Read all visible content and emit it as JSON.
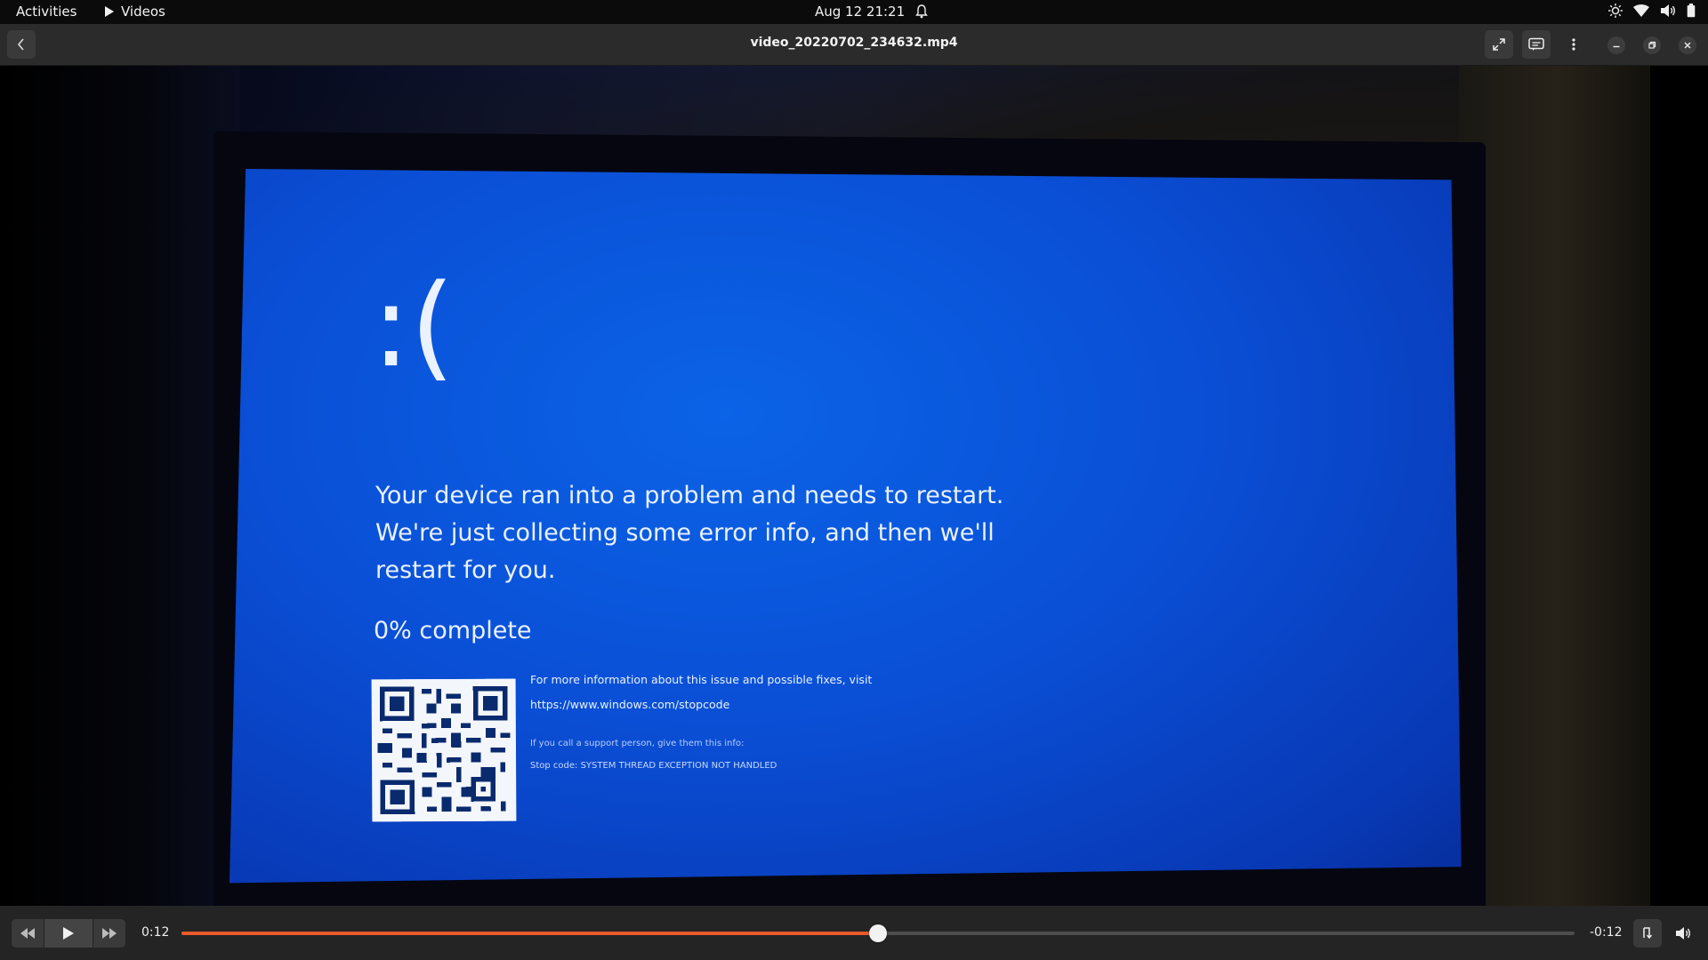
{
  "topbar": {
    "activities_label": "Activities",
    "app_name": "Videos",
    "clock": "Aug 12  21:21",
    "tray_icons": [
      "brightness-icon",
      "wifi-icon",
      "volume-icon",
      "battery-icon"
    ]
  },
  "header": {
    "title": "video_20220702_234632.mp4",
    "buttons": [
      "back",
      "fullscreen",
      "subtitles",
      "menu",
      "minimize",
      "restore",
      "close"
    ]
  },
  "video": {
    "sad_face": ":(",
    "message": "Your device ran into a problem and needs to restart. We're just collecting some error info, and then we'll restart for you.",
    "progress": "0% complete",
    "more_info": "For more information about this issue and possible fixes, visit",
    "url": "https://www.windows.com/stopcode",
    "support": "If you call a support person, give them this info:",
    "stop_code": "Stop code: SYSTEM THREAD EXCEPTION NOT HANDLED"
  },
  "player": {
    "elapsed": "0:12",
    "remaining": "-0:12",
    "progress_fraction": 0.5,
    "accent_color": "#e85a2a"
  }
}
